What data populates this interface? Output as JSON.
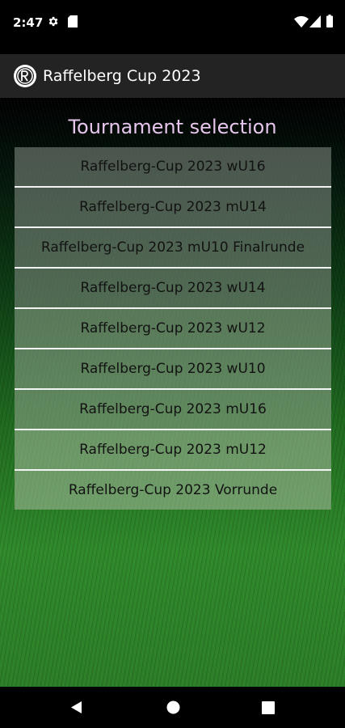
{
  "status_bar": {
    "time": "2:47",
    "icons": [
      "gear-icon",
      "sd-card-icon",
      "wifi-icon",
      "signal-icon",
      "battery-icon"
    ]
  },
  "app_bar": {
    "title": "Raffelberg Cup 2023",
    "logo_icon": "club-logo-icon"
  },
  "main": {
    "title": "Tournament selection",
    "tournaments": [
      {
        "label": "Raffelberg-Cup 2023 wU16"
      },
      {
        "label": "Raffelberg-Cup 2023 mU14"
      },
      {
        "label": "Raffelberg-Cup 2023 mU10 Finalrunde"
      },
      {
        "label": "Raffelberg-Cup 2023 wU14"
      },
      {
        "label": "Raffelberg-Cup 2023 wU12"
      },
      {
        "label": "Raffelberg-Cup 2023 wU10"
      },
      {
        "label": "Raffelberg-Cup 2023 mU16"
      },
      {
        "label": "Raffelberg-Cup 2023 mU12"
      },
      {
        "label": "Raffelberg-Cup 2023 Vorrunde"
      }
    ]
  },
  "nav_bar": {
    "icons": [
      "back-icon",
      "home-icon",
      "recents-icon"
    ]
  },
  "colors": {
    "title_color": "#e6c6ec",
    "app_bar_bg": "#232323",
    "item_text": "#121212"
  }
}
